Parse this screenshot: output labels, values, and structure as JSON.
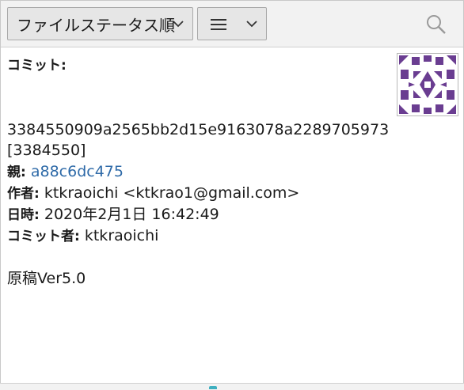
{
  "toolbar": {
    "sort_label": "ファイルステータス順",
    "sort_chevron_icon": "chevron-down-icon",
    "view_icon": "menu-lines-icon",
    "view_chevron_icon": "chevron-down-icon",
    "search_icon": "search-icon"
  },
  "commit": {
    "commit_label": "コミット:",
    "hash": "3384550909a2565bb2d15e9163078a2289705973",
    "short_hash": "[3384550]",
    "parent_label": "親:",
    "parent_hash": "a88c6dc475",
    "author_label": "作者:",
    "author": "ktkraoichi <ktkrao1@gmail.com>",
    "date_label": "日時:",
    "date": "2020年2月1日 16:42:49",
    "committer_label": "コミット者:",
    "committer": "ktkraoichi",
    "message": "原稿Ver5.0"
  },
  "colors": {
    "avatar": "#6a3d91",
    "link": "#2e6aa8",
    "toolbar_bg": "#f2f2f2",
    "button_bg": "#e6e6e6"
  }
}
